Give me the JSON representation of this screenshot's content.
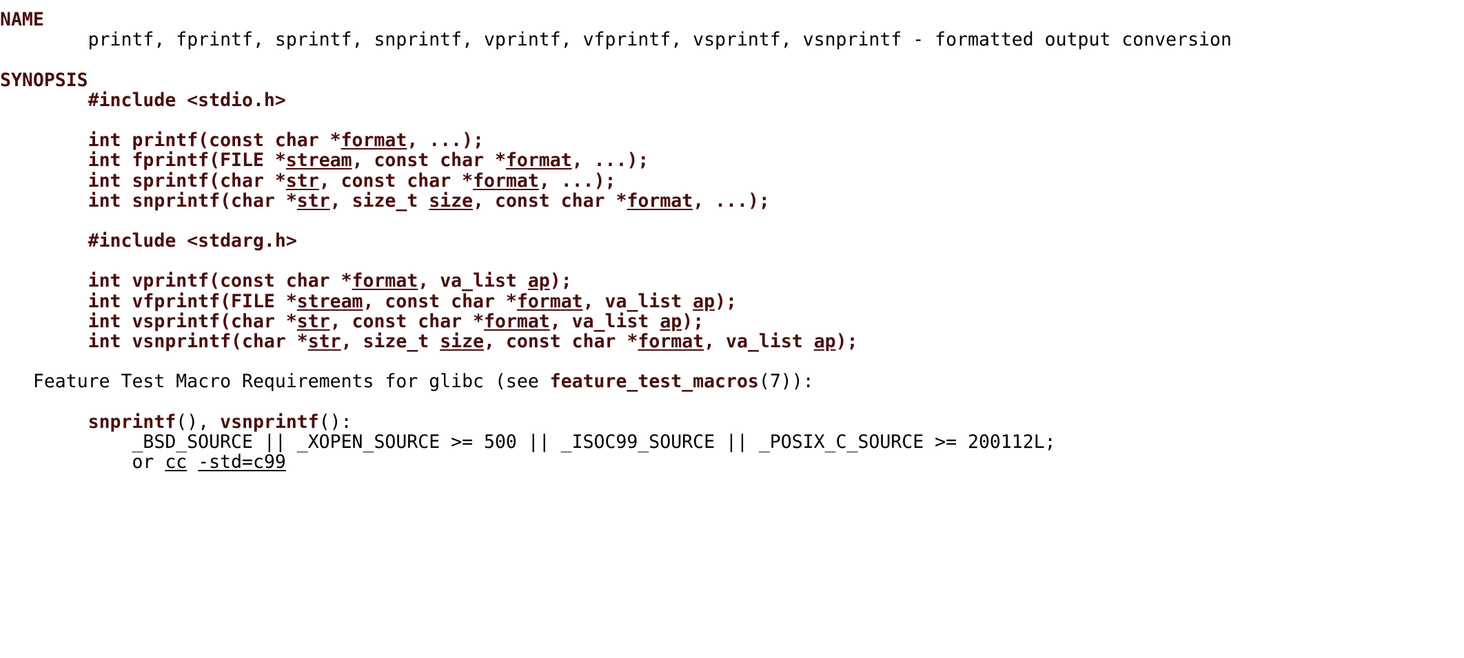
{
  "document": {
    "kind": "man-page",
    "name": "printf(3)",
    "text_color": "#000000",
    "accent_color": "#4a0d0d",
    "background_color": "#ffffff"
  },
  "sections": [
    {
      "heading": "NAME",
      "lines": [
        {
          "indent": 8,
          "runs": [
            {
              "style": "plain",
              "text": "printf, fprintf, sprintf, snprintf, vprintf, vfprintf, vsprintf, vsnprintf - formatted output conversion"
            }
          ]
        }
      ]
    },
    {
      "heading": "SYNOPSIS",
      "lines": [
        {
          "indent": 8,
          "runs": [
            {
              "style": "bold",
              "text": "#include <stdio.h>"
            }
          ]
        },
        {
          "indent": 0,
          "runs": [
            {
              "style": "plain",
              "text": ""
            }
          ]
        },
        {
          "indent": 8,
          "runs": [
            {
              "style": "bold",
              "text": "int printf(const char *"
            },
            {
              "style": "ital",
              "text": "format"
            },
            {
              "style": "bold",
              "text": ", ...);"
            }
          ]
        },
        {
          "indent": 8,
          "runs": [
            {
              "style": "bold",
              "text": "int fprintf(FILE *"
            },
            {
              "style": "ital",
              "text": "stream"
            },
            {
              "style": "bold",
              "text": ", const char *"
            },
            {
              "style": "ital",
              "text": "format"
            },
            {
              "style": "bold",
              "text": ", ...);"
            }
          ]
        },
        {
          "indent": 8,
          "runs": [
            {
              "style": "bold",
              "text": "int sprintf(char *"
            },
            {
              "style": "ital",
              "text": "str"
            },
            {
              "style": "bold",
              "text": ", const char *"
            },
            {
              "style": "ital",
              "text": "format"
            },
            {
              "style": "bold",
              "text": ", ...);"
            }
          ]
        },
        {
          "indent": 8,
          "runs": [
            {
              "style": "bold",
              "text": "int snprintf(char *"
            },
            {
              "style": "ital",
              "text": "str"
            },
            {
              "style": "bold",
              "text": ", size_t "
            },
            {
              "style": "ital",
              "text": "size"
            },
            {
              "style": "bold",
              "text": ", const char *"
            },
            {
              "style": "ital",
              "text": "format"
            },
            {
              "style": "bold",
              "text": ", ...);"
            }
          ]
        },
        {
          "indent": 0,
          "runs": [
            {
              "style": "plain",
              "text": ""
            }
          ]
        },
        {
          "indent": 8,
          "runs": [
            {
              "style": "bold",
              "text": "#include <stdarg.h>"
            }
          ]
        },
        {
          "indent": 0,
          "runs": [
            {
              "style": "plain",
              "text": ""
            }
          ]
        },
        {
          "indent": 8,
          "runs": [
            {
              "style": "bold",
              "text": "int vprintf(const char *"
            },
            {
              "style": "ital",
              "text": "format"
            },
            {
              "style": "bold",
              "text": ", va_list "
            },
            {
              "style": "ital",
              "text": "ap"
            },
            {
              "style": "bold",
              "text": ");"
            }
          ]
        },
        {
          "indent": 8,
          "runs": [
            {
              "style": "bold",
              "text": "int vfprintf(FILE *"
            },
            {
              "style": "ital",
              "text": "stream"
            },
            {
              "style": "bold",
              "text": ", const char *"
            },
            {
              "style": "ital",
              "text": "format"
            },
            {
              "style": "bold",
              "text": ", va_list "
            },
            {
              "style": "ital",
              "text": "ap"
            },
            {
              "style": "bold",
              "text": ");"
            }
          ]
        },
        {
          "indent": 8,
          "runs": [
            {
              "style": "bold",
              "text": "int vsprintf(char *"
            },
            {
              "style": "ital",
              "text": "str"
            },
            {
              "style": "bold",
              "text": ", const char *"
            },
            {
              "style": "ital",
              "text": "format"
            },
            {
              "style": "bold",
              "text": ", va_list "
            },
            {
              "style": "ital",
              "text": "ap"
            },
            {
              "style": "bold",
              "text": ");"
            }
          ]
        },
        {
          "indent": 8,
          "runs": [
            {
              "style": "bold",
              "text": "int vsnprintf(char *"
            },
            {
              "style": "ital",
              "text": "str"
            },
            {
              "style": "bold",
              "text": ", size_t "
            },
            {
              "style": "ital",
              "text": "size"
            },
            {
              "style": "bold",
              "text": ", const char *"
            },
            {
              "style": "ital",
              "text": "format"
            },
            {
              "style": "bold",
              "text": ", va_list "
            },
            {
              "style": "ital",
              "text": "ap"
            },
            {
              "style": "bold",
              "text": ");"
            }
          ]
        },
        {
          "indent": 0,
          "runs": [
            {
              "style": "plain",
              "text": ""
            }
          ]
        },
        {
          "indent": 3,
          "runs": [
            {
              "style": "plain",
              "text": "Feature Test Macro Requirements for glibc (see "
            },
            {
              "style": "bold",
              "text": "feature_test_macros"
            },
            {
              "style": "plain",
              "text": "(7)):"
            }
          ]
        },
        {
          "indent": 0,
          "runs": [
            {
              "style": "plain",
              "text": ""
            }
          ]
        },
        {
          "indent": 8,
          "runs": [
            {
              "style": "bold",
              "text": "snprintf"
            },
            {
              "style": "plain",
              "text": "(), "
            },
            {
              "style": "bold",
              "text": "vsnprintf"
            },
            {
              "style": "plain",
              "text": "():"
            }
          ]
        },
        {
          "indent": 12,
          "runs": [
            {
              "style": "plain",
              "text": "_BSD_SOURCE || _XOPEN_SOURCE >= 500 || _ISOC99_SOURCE || _POSIX_C_SOURCE >= 200112L;"
            }
          ]
        },
        {
          "indent": 12,
          "runs": [
            {
              "style": "plain",
              "text": "or "
            },
            {
              "style": "plain-ital",
              "text": "cc"
            },
            {
              "style": "plain",
              "text": " "
            },
            {
              "style": "plain-ital",
              "text": "-std=c99"
            }
          ]
        }
      ]
    }
  ]
}
